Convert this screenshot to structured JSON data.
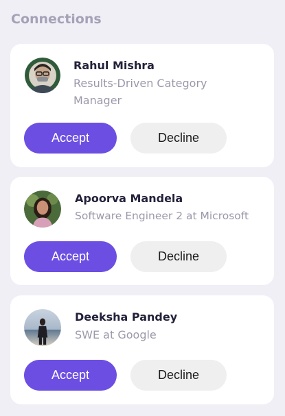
{
  "section": {
    "title": "Connections"
  },
  "colors": {
    "accent": "#6c4fe2",
    "background": "#f0eff6",
    "decline": "#efefef"
  },
  "requests": [
    {
      "name": "Rahul Mishra",
      "headline": "Results-Driven Category Manager",
      "avatar": "profile-photo",
      "accept_label": "Accept",
      "decline_label": "Decline"
    },
    {
      "name": "Apoorva Mandela",
      "headline": "Software Engineer 2 at Microsoft",
      "avatar": "profile-photo",
      "accept_label": "Accept",
      "decline_label": "Decline"
    },
    {
      "name": "Deeksha Pandey",
      "headline": "SWE at Google",
      "avatar": "profile-photo",
      "accept_label": "Accept",
      "decline_label": "Decline"
    }
  ]
}
